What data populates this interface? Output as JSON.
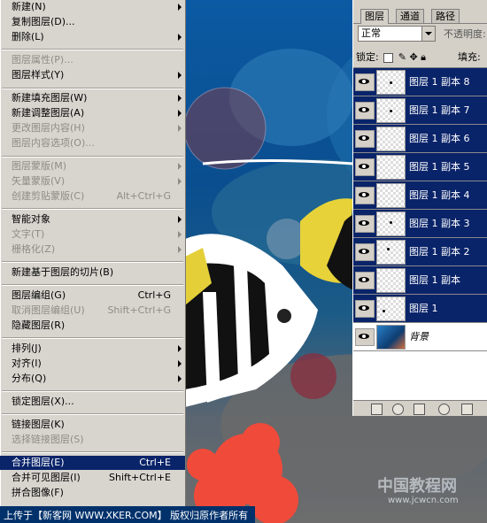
{
  "menu": {
    "items": [
      {
        "label": "新建(N)",
        "shortcut": "",
        "submenu": true,
        "disabled": false
      },
      {
        "label": "复制图层(D)...",
        "shortcut": "",
        "submenu": false,
        "disabled": false
      },
      {
        "label": "删除(L)",
        "shortcut": "",
        "submenu": true,
        "disabled": false
      },
      {
        "label": "图层属性(P)...",
        "shortcut": "",
        "submenu": false,
        "disabled": true
      },
      {
        "label": "图层样式(Y)",
        "shortcut": "",
        "submenu": true,
        "disabled": false
      },
      {
        "label": "新建填充图层(W)",
        "shortcut": "",
        "submenu": true,
        "disabled": false
      },
      {
        "label": "新建调整图层(A)",
        "shortcut": "",
        "submenu": true,
        "disabled": false
      },
      {
        "label": "更改图层内容(H)",
        "shortcut": "",
        "submenu": true,
        "disabled": true
      },
      {
        "label": "图层内容选项(O)...",
        "shortcut": "",
        "submenu": false,
        "disabled": true
      },
      {
        "label": "图层蒙版(M)",
        "shortcut": "",
        "submenu": true,
        "disabled": true
      },
      {
        "label": "矢量蒙版(V)",
        "shortcut": "",
        "submenu": true,
        "disabled": true
      },
      {
        "label": "创建剪贴蒙版(C)",
        "shortcut": "Alt+Ctrl+G",
        "submenu": false,
        "disabled": true
      },
      {
        "label": "智能对象",
        "shortcut": "",
        "submenu": true,
        "disabled": false
      },
      {
        "label": "文字(T)",
        "shortcut": "",
        "submenu": true,
        "disabled": true
      },
      {
        "label": "栅格化(Z)",
        "shortcut": "",
        "submenu": true,
        "disabled": true
      },
      {
        "label": "新建基于图层的切片(B)",
        "shortcut": "",
        "submenu": false,
        "disabled": false
      },
      {
        "label": "图层编组(G)",
        "shortcut": "Ctrl+G",
        "submenu": false,
        "disabled": false
      },
      {
        "label": "取消图层编组(U)",
        "shortcut": "Shift+Ctrl+G",
        "submenu": false,
        "disabled": true
      },
      {
        "label": "隐藏图层(R)",
        "shortcut": "",
        "submenu": false,
        "disabled": false
      },
      {
        "label": "排列(J)",
        "shortcut": "",
        "submenu": true,
        "disabled": false
      },
      {
        "label": "对齐(I)",
        "shortcut": "",
        "submenu": true,
        "disabled": false
      },
      {
        "label": "分布(Q)",
        "shortcut": "",
        "submenu": true,
        "disabled": false
      },
      {
        "label": "锁定图层(X)...",
        "shortcut": "",
        "submenu": false,
        "disabled": false
      },
      {
        "label": "链接图层(K)",
        "shortcut": "",
        "submenu": false,
        "disabled": false
      },
      {
        "label": "选择链接图层(S)",
        "shortcut": "",
        "submenu": false,
        "disabled": true
      },
      {
        "label": "合并图层(E)",
        "shortcut": "Ctrl+E",
        "submenu": false,
        "disabled": false,
        "highlight": true
      },
      {
        "label": "合并可见图层(I)",
        "shortcut": "Shift+Ctrl+E",
        "submenu": false,
        "disabled": false
      },
      {
        "label": "拼合图像(F)",
        "shortcut": "",
        "submenu": false,
        "disabled": false
      }
    ]
  },
  "panel": {
    "tabs": [
      "图层",
      "通道",
      "路径"
    ],
    "blend_mode": "正常",
    "opacity_label": "不透明度:",
    "lock_label": "锁定:",
    "fill_label": "填充:",
    "layers": [
      {
        "name": "图层 1 副本 8",
        "selected": true
      },
      {
        "name": "图层 1 副本 7",
        "selected": true
      },
      {
        "name": "图层 1 副本 6",
        "selected": true
      },
      {
        "name": "图层 1 副本 5",
        "selected": true
      },
      {
        "name": "图层 1 副本 4",
        "selected": true
      },
      {
        "name": "图层 1 副本 3",
        "selected": true
      },
      {
        "name": "图层 1 副本 2",
        "selected": true
      },
      {
        "name": "图层 1 副本",
        "selected": true
      },
      {
        "name": "图层 1",
        "selected": true
      },
      {
        "name": "背景",
        "selected": false,
        "italic": true
      }
    ]
  },
  "bottombar": {
    "text": "上传于【新客网 WWW.XKER.COM】 版权归原作者所有"
  },
  "watermark": {
    "text": "中国教程网",
    "url": "www.jcwcn.com"
  },
  "colors": {
    "highlight": "#0a246a",
    "menu_bg": "#d8d5cf",
    "panel_bg": "#d4d0c8"
  }
}
